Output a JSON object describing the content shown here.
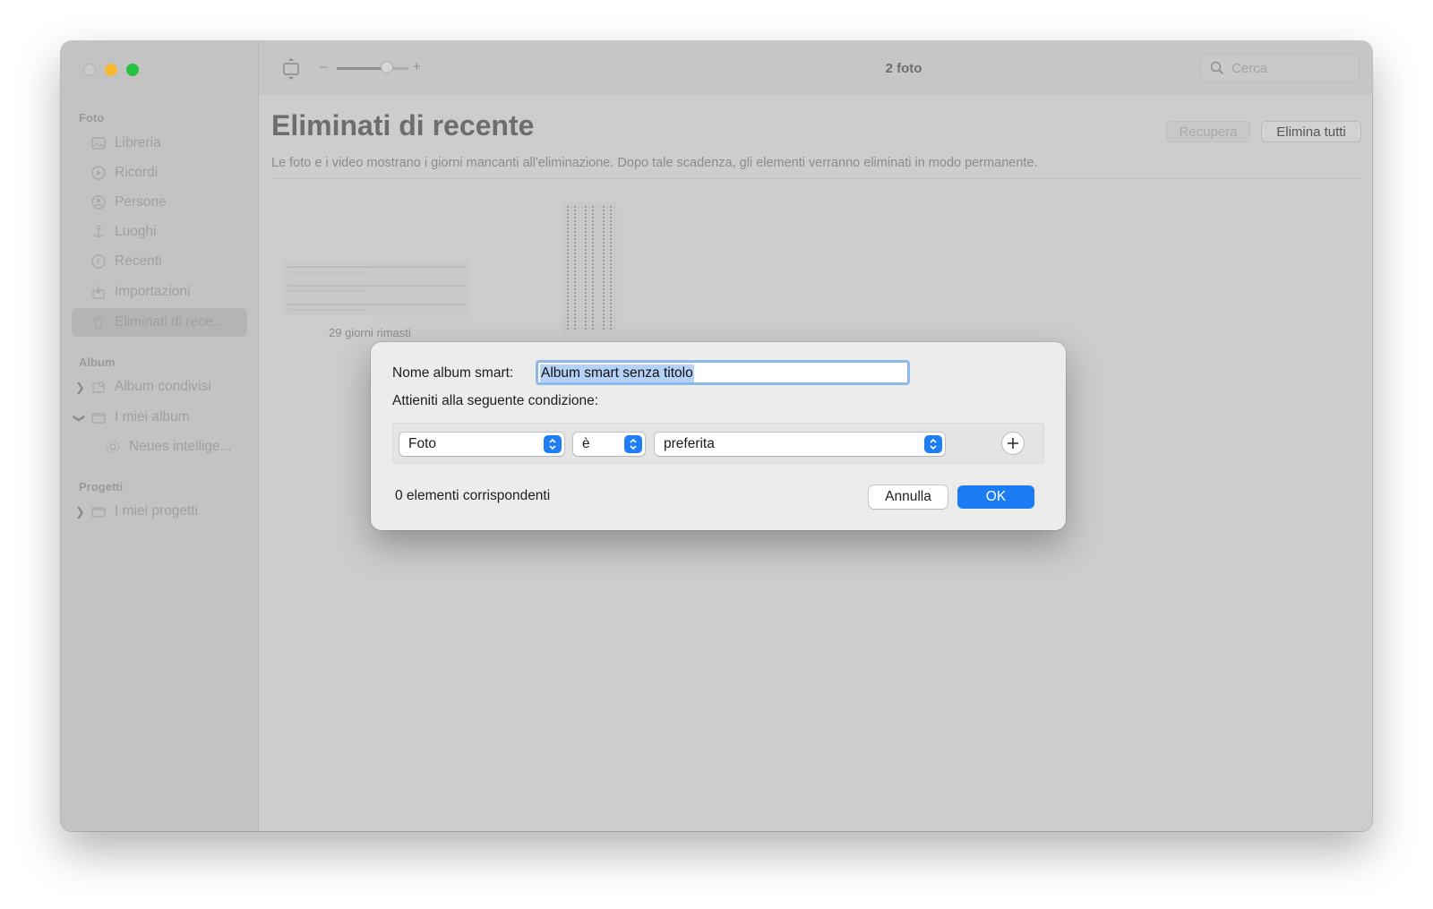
{
  "toolbar": {
    "title": "2 foto",
    "search_placeholder": "Cerca",
    "zoom_minus": "–",
    "zoom_plus": "+",
    "zoom_level": 0.7
  },
  "sidebar": {
    "sections": {
      "foto": "Foto",
      "album": "Album",
      "progetti": "Progetti"
    },
    "items": [
      {
        "label": "Libreria",
        "icon": "photo-library-icon"
      },
      {
        "label": "Ricordi",
        "icon": "memories-icon"
      },
      {
        "label": "Persone",
        "icon": "people-icon"
      },
      {
        "label": "Luoghi",
        "icon": "places-icon"
      },
      {
        "label": "Recenti",
        "icon": "clock-icon"
      },
      {
        "label": "Importazioni",
        "icon": "import-icon"
      },
      {
        "label": "Eliminati di rece...",
        "icon": "trash-icon",
        "selected": true
      }
    ],
    "album_items": [
      {
        "label": "Album condivisi",
        "icon": "shared-album-icon"
      },
      {
        "label": "I miei album",
        "icon": "folder-icon"
      },
      {
        "label": "Neues intellige...",
        "icon": "gear-icon"
      }
    ],
    "project_items": [
      {
        "label": "I miei progetti",
        "icon": "folder-icon"
      }
    ]
  },
  "main": {
    "title": "Eliminati di recente",
    "description": "Le foto e i video mostrano i giorni mancanti all'eliminazione. Dopo tale scadenza, gli elementi verranno eliminati in modo permanente.",
    "recupera_label": "Recupera",
    "elimina_tutti_label": "Elimina tutti",
    "thumb_caption": "29 giorni rimasti"
  },
  "dialog": {
    "name_label": "Nome album smart:",
    "name_value": "Album smart senza titolo",
    "condition_label": "Attieniti alla seguente condizione:",
    "rule": {
      "field": "Foto",
      "operator": "è",
      "value": "preferita"
    },
    "match_count": "0 elementi corrispondenti",
    "cancel_label": "Annulla",
    "ok_label": "OK"
  },
  "colors": {
    "accent": "#1b7cf4",
    "close": "#c9c9c9",
    "minimize": "#f6b82f",
    "maximize": "#27c23f"
  }
}
